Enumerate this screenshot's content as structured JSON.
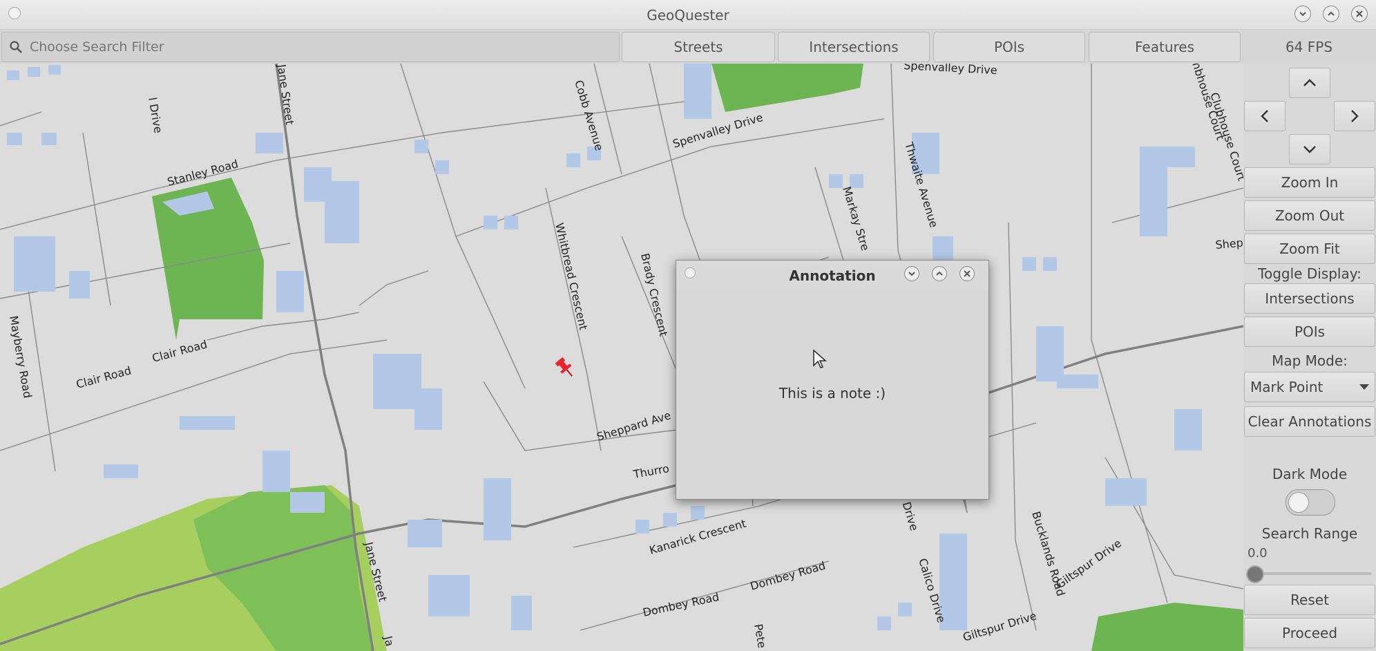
{
  "window": {
    "title": "GeoQuester"
  },
  "toolbar": {
    "search_placeholder": "Choose Search Filter",
    "tabs": [
      "Streets",
      "Intersections",
      "POIs",
      "Features"
    ],
    "fps": "64 FPS"
  },
  "map": {
    "streets": {
      "drive_top": "l Drive",
      "jane1": "Jane Street",
      "jane2": "Jane Street",
      "jane3": "Ja",
      "stanley": "Stanley Road",
      "cobb": "Cobb Avenue",
      "spen1": "Spenvalley Drive",
      "spen2": "Spenvalley Drive",
      "thwaite": "Thwaite Avenue",
      "markay": "Markay Stre",
      "whitbread": "Whitbread Crescent",
      "brady": "Brady Crescent",
      "clubhouse": "Clubhouse Court",
      "hbhouse": "hbhouse Court",
      "shep_right": "Shep",
      "mayberry": "Mayberry Road",
      "clair1": "Clair Road",
      "clair2": "Clair Road",
      "sheppard": "Sheppard Ave",
      "thurro": "Thurro",
      "kanarick": "Kanarick Crescent",
      "dombey1": "Dombey Road",
      "dombey2": "Dombey Road",
      "pete": "Pete",
      "calico1": "Calico Drive",
      "calico2": "o Drive",
      "bucklands": "Bucklands Road",
      "giltspur1": "Giltspur Drive",
      "giltspur2": "Giltspur Drive"
    },
    "marker_icon": "pushpin-icon"
  },
  "panel": {
    "zoom_in": "Zoom In",
    "zoom_out": "Zoom Out",
    "zoom_fit": "Zoom Fit",
    "toggle_display_label": "Toggle Display:",
    "toggle_intersections": "Intersections",
    "toggle_pois": "POIs",
    "map_mode_label": "Map Mode:",
    "map_mode_value": "Mark Point",
    "clear_annotations": "Clear Annotations",
    "dark_mode_label": "Dark Mode",
    "dark_mode_on": false,
    "search_range_label": "Search Range",
    "search_range_value": "0.0",
    "reset": "Reset",
    "proceed": "Proceed"
  },
  "dialog": {
    "title": "Annotation",
    "note": "This is a note :)"
  },
  "colors": {
    "building": "#b3c8e6",
    "park": "#6db552",
    "light_park": "#a6cf5f",
    "road": "#8a8a8a",
    "marker": "#e8232a"
  }
}
